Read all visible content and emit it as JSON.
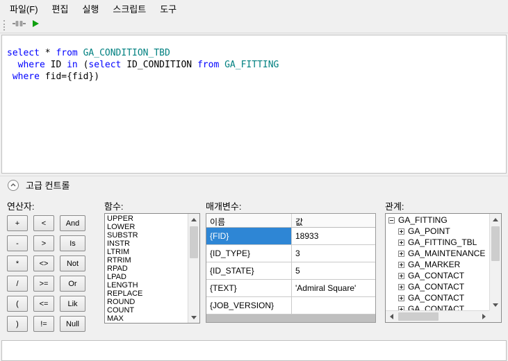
{
  "colors": {
    "keyword": "#0000ff",
    "object_name": "#008080",
    "selection": "#2e86d5",
    "run_green": "#0fa00f"
  },
  "menu_bar": {
    "items": [
      {
        "id": "file",
        "label": "파일(F)"
      },
      {
        "id": "edit",
        "label": "편집"
      },
      {
        "id": "run",
        "label": "실행"
      },
      {
        "id": "script",
        "label": "스크립트"
      },
      {
        "id": "tools",
        "label": "도구"
      }
    ]
  },
  "toolbar": {
    "icons": [
      {
        "name": "connect-icon"
      },
      {
        "name": "run-icon"
      }
    ]
  },
  "sql_editor": {
    "lines": [
      [
        {
          "t": "select",
          "c": "kw"
        },
        {
          "t": " * ",
          "c": "txt"
        },
        {
          "t": "from",
          "c": "kw"
        },
        {
          "t": " ",
          "c": "txt"
        },
        {
          "t": "GA_CONDITION_TBD",
          "c": "obj"
        }
      ],
      [
        {
          "t": "  ",
          "c": "txt"
        },
        {
          "t": "where",
          "c": "kw"
        },
        {
          "t": " ID ",
          "c": "txt"
        },
        {
          "t": "in",
          "c": "kw"
        },
        {
          "t": " (",
          "c": "txt"
        },
        {
          "t": "select",
          "c": "kw"
        },
        {
          "t": " ID_CONDITION ",
          "c": "txt"
        },
        {
          "t": "from",
          "c": "kw"
        },
        {
          "t": " ",
          "c": "txt"
        },
        {
          "t": "GA_FITTING",
          "c": "obj"
        }
      ],
      [
        {
          "t": " ",
          "c": "txt"
        },
        {
          "t": "where",
          "c": "kw"
        },
        {
          "t": " fid={fid})",
          "c": "txt"
        }
      ]
    ]
  },
  "advanced": {
    "label": "고급 컨트롤"
  },
  "operators": {
    "label": "연산자:",
    "buttons": [
      "+",
      "<",
      "And",
      "-",
      ">",
      "Is",
      "*",
      "<>",
      "Not",
      "/",
      ">=",
      "Or",
      "(",
      "<=",
      "Lik",
      ")",
      "!=",
      "Null"
    ]
  },
  "functions": {
    "label": "함수:",
    "items": [
      "UPPER",
      "LOWER",
      "SUBSTR",
      "INSTR",
      "LTRIM",
      "RTRIM",
      "RPAD",
      "LPAD",
      "LENGTH",
      "REPLACE",
      "ROUND",
      "COUNT",
      "MAX"
    ]
  },
  "parameters": {
    "label": "매개변수:",
    "columns": [
      "이름",
      "값"
    ],
    "rows": [
      {
        "name": "{FID}",
        "value": "18933",
        "selected": true
      },
      {
        "name": "{ID_TYPE}",
        "value": "3",
        "selected": false
      },
      {
        "name": "{ID_STATE}",
        "value": "5",
        "selected": false
      },
      {
        "name": "{TEXT}",
        "value": "'Admiral Square'",
        "selected": false
      },
      {
        "name": "{JOB_VERSION}",
        "value": "",
        "selected": false
      }
    ]
  },
  "relations": {
    "label": "관계:",
    "nodes": [
      {
        "label": "GA_FITTING",
        "expander": "minus",
        "level": 0
      },
      {
        "label": "GA_POINT",
        "expander": "plus",
        "level": 1
      },
      {
        "label": "GA_FITTING_TBL",
        "expander": "plus",
        "level": 1
      },
      {
        "label": "GA_MAINTENANCE",
        "expander": "plus",
        "level": 1
      },
      {
        "label": "GA_MARKER",
        "expander": "plus",
        "level": 1
      },
      {
        "label": "GA_CONTACT",
        "expander": "plus",
        "level": 1
      },
      {
        "label": "GA_CONTACT",
        "expander": "plus",
        "level": 1
      },
      {
        "label": "GA_CONTACT",
        "expander": "plus",
        "level": 1
      },
      {
        "label": "GA_CONTACT",
        "expander": "plus",
        "level": 1
      }
    ]
  }
}
